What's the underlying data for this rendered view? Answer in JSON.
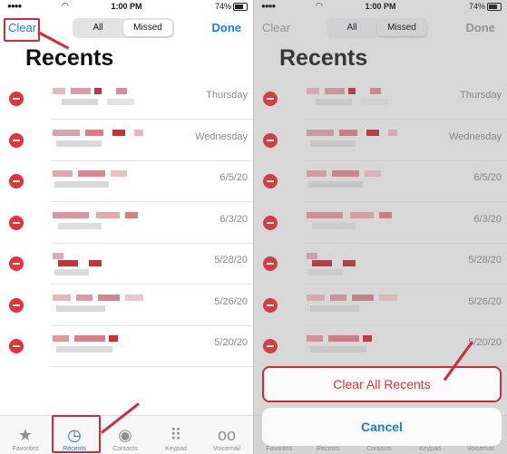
{
  "status": {
    "time": "1:00 PM",
    "battery": "74%"
  },
  "nav": {
    "clear": "Clear",
    "seg_all": "All",
    "seg_missed": "Missed",
    "done": "Done"
  },
  "title": "Recents",
  "dates": [
    "Thursday",
    "Wednesday",
    "6/5/20",
    "6/3/20",
    "5/28/20",
    "5/26/20",
    "5/20/20"
  ],
  "tabs": [
    {
      "label": "Favorites",
      "icon": "star-icon"
    },
    {
      "label": "Recents",
      "icon": "clock-icon"
    },
    {
      "label": "Contacts",
      "icon": "person-icon"
    },
    {
      "label": "Keypad",
      "icon": "keypad-icon"
    },
    {
      "label": "Voicemail",
      "icon": "voicemail-icon"
    }
  ],
  "sheet": {
    "clear_all": "Clear All Recents",
    "cancel": "Cancel"
  },
  "colors": {
    "accent": "#1a7cf0",
    "delete": "#e6323a",
    "highlight": "#d22a3a"
  }
}
